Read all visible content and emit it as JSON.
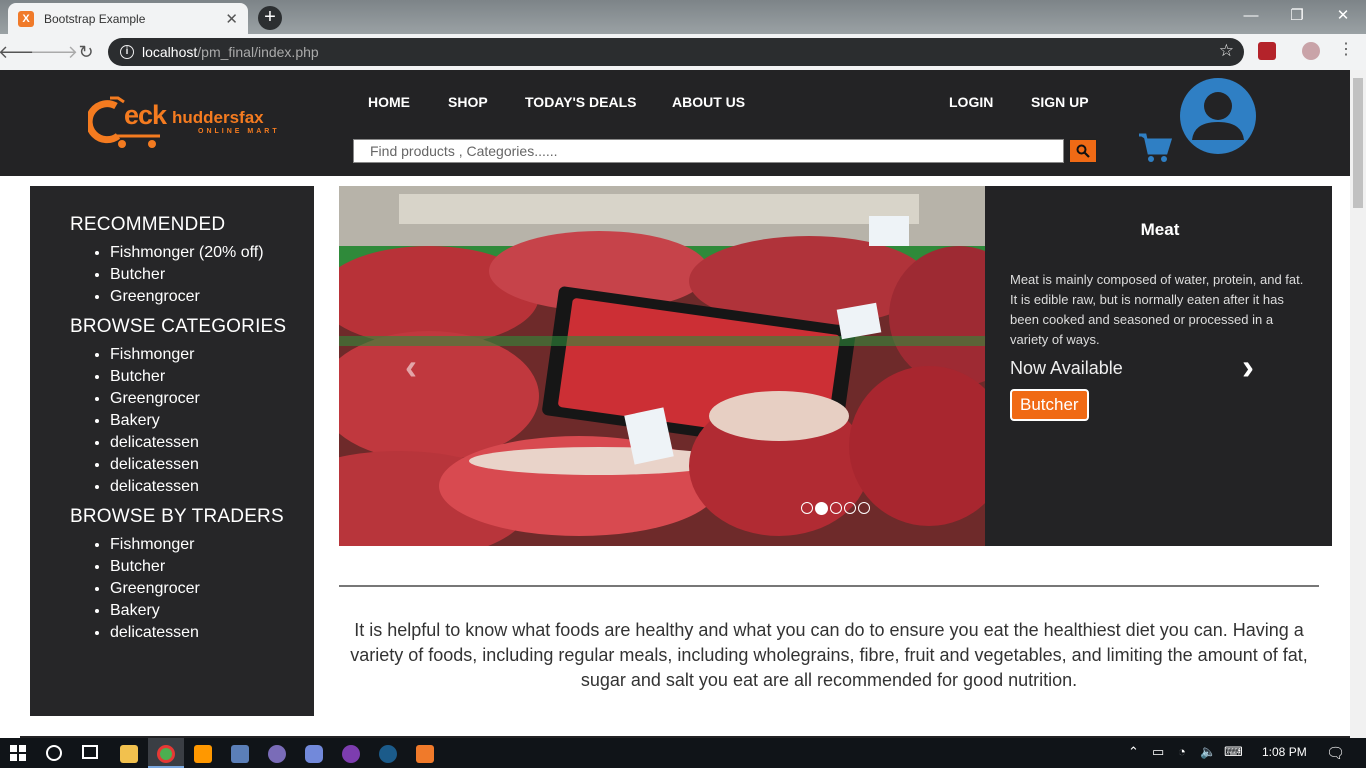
{
  "browser": {
    "tab_title": "Bootstrap Example",
    "tab_favicon": "X",
    "url_host": "localhost",
    "url_path": "/pm_final/index.php"
  },
  "site": {
    "logo_brand": "eck",
    "logo_brand2": "huddersfax",
    "logo_sub": "ONLINE MART",
    "nav": {
      "home": "HOME",
      "shop": "SHOP",
      "deals": "TODAY'S DEALS",
      "about": "ABOUT US",
      "login": "LOGIN",
      "signup": "SIGN UP"
    },
    "search_placeholder": "Find products , Categories......",
    "accent": "#f06a15",
    "header_bg": "#232325"
  },
  "sidebar": {
    "recommended_title": "RECOMMENDED",
    "recommended": [
      "Fishmonger (20% off)",
      "Butcher",
      "Greengrocer"
    ],
    "categories_title": "BROWSE CATEGORIES",
    "categories": [
      "Fishmonger",
      "Butcher",
      "Greengrocer",
      "Bakery",
      "delicatessen",
      "delicatessen",
      "delicatessen"
    ],
    "traders_title": "BROWSE BY TRADERS",
    "traders": [
      "Fishmonger",
      "Butcher",
      "Greengrocer",
      "Bakery",
      "delicatessen"
    ]
  },
  "carousel": {
    "title": "Meat",
    "description": "Meat is mainly composed of water, protein, and fat. It is edible raw, but is normally eaten after it has been cooked and seasoned or processed in a variety of ways.",
    "availability": "Now Available",
    "button_label": "Butcher",
    "prev_glyph": "‹",
    "next_glyph": "›",
    "slide_count": 5,
    "active_slide": 1
  },
  "intro_text": "It is helpful to know what foods are healthy and what you can do to ensure you eat the healthiest diet you can. Having a variety of foods, including regular meals, including wholegrains, fibre, fruit and vegetables, and limiting the amount of fat, sugar and salt you eat are all recommended for good nutrition.",
  "taskbar": {
    "clock": "1:08 PM"
  }
}
